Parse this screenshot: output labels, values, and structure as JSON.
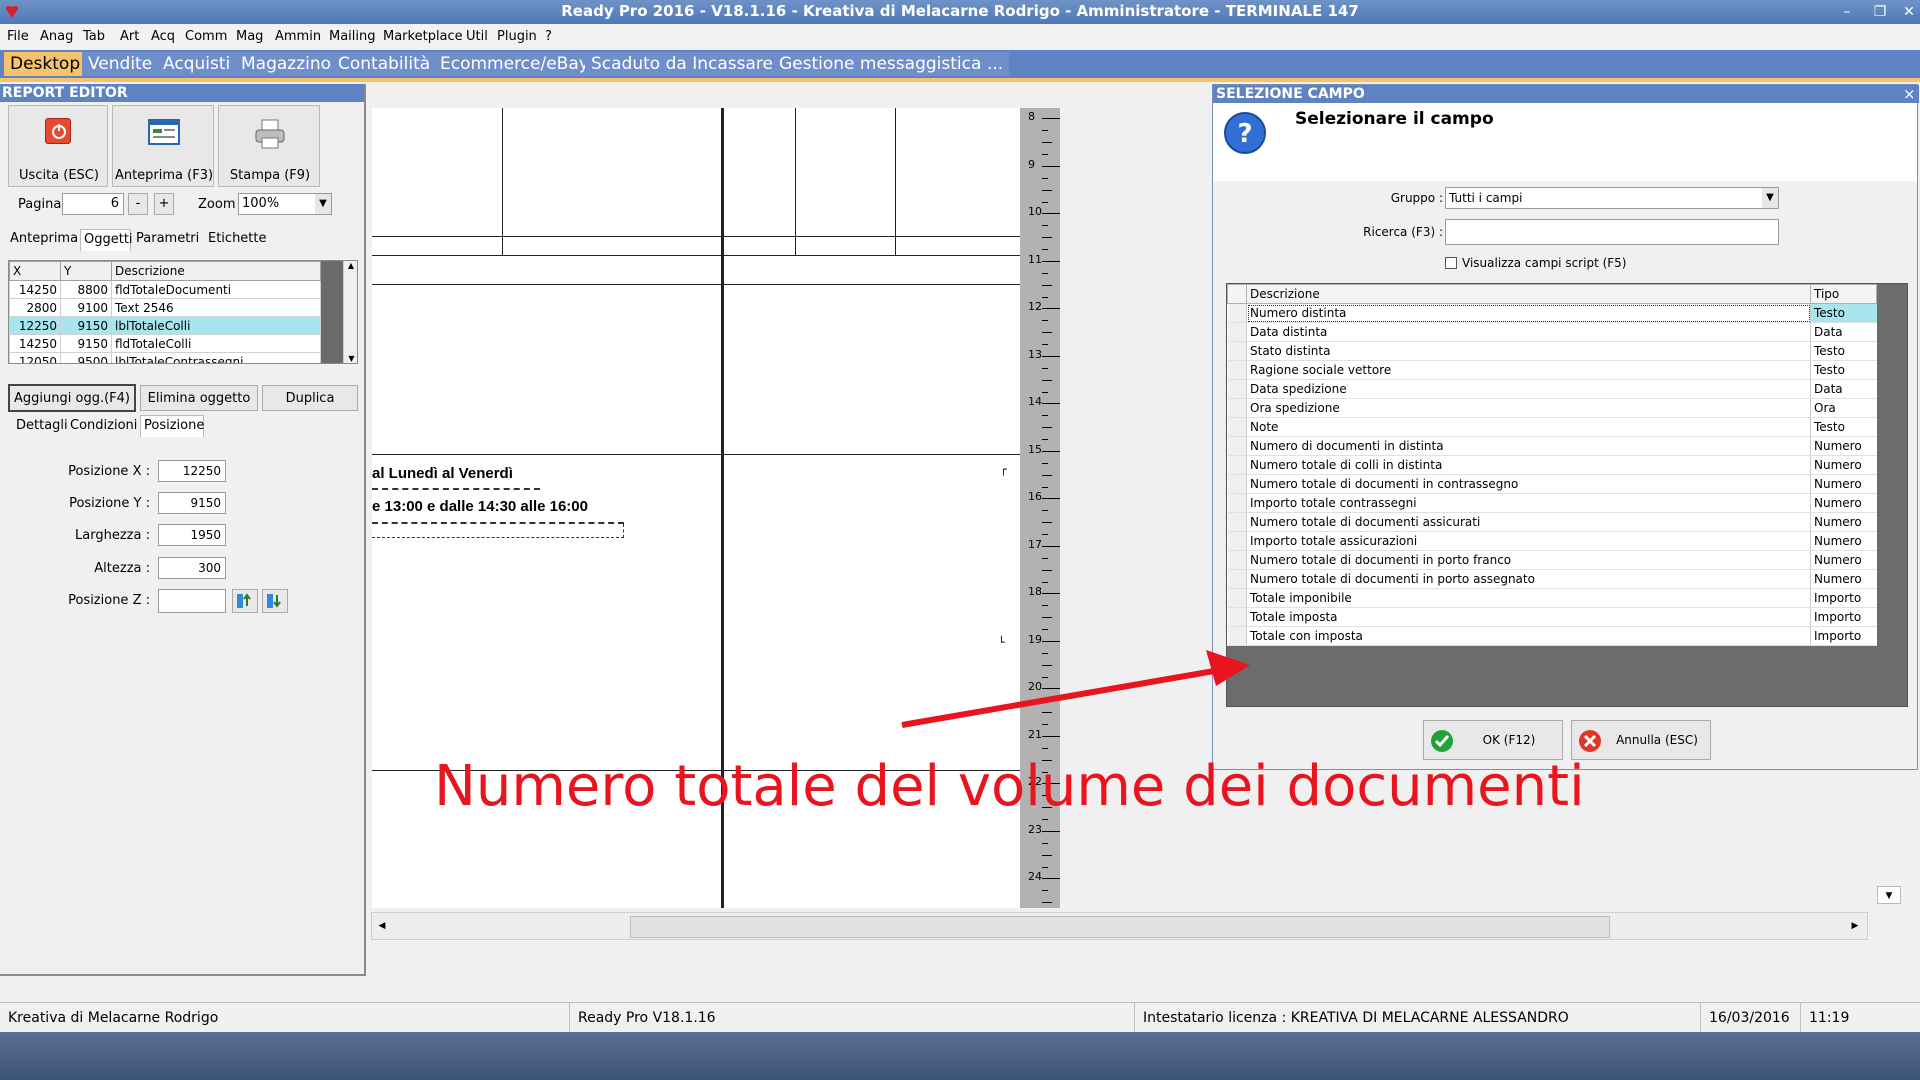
{
  "window": {
    "title": "Ready Pro 2016 - V18.1.16 - Kreativa di Melacarne Rodrigo - Amministratore - TERMINALE 147"
  },
  "menu": [
    "File",
    "Anag",
    "Tab",
    "Art",
    "Acq",
    "Comm",
    "Mag",
    "Ammin",
    "Mailing",
    "Marketplace",
    "Util",
    "Plugin",
    "?"
  ],
  "tabs": [
    "Desktop",
    "Vendite",
    "Acquisti",
    "Magazzino",
    "Contabilità",
    "Ecommerce/eBay",
    "Scaduto da Incassare",
    "Gestione messaggistica",
    "..."
  ],
  "report_editor": {
    "title": "REPORT EDITOR",
    "buttons": {
      "exit": "Uscita (ESC)",
      "preview": "Anteprima (F3)",
      "print": "Stampa (F9)"
    },
    "page_label": "Pagina",
    "page_value": "6",
    "minus": "-",
    "plus": "+",
    "zoom_label": "Zoom",
    "zoom_value": "100%",
    "tabs": [
      "Anteprima",
      "Oggetti",
      "Parametri",
      "Etichette"
    ],
    "grid_headers": [
      "X",
      "Y",
      "Descrizione"
    ],
    "grid_rows": [
      [
        "14250",
        "8800",
        "fldTotaleDocumenti"
      ],
      [
        "2800",
        "9100",
        "Text 2546"
      ],
      [
        "12250",
        "9150",
        "lblTotaleColli"
      ],
      [
        "14250",
        "9150",
        "fldTotaleColli"
      ],
      [
        "12050",
        "9500",
        "lblTotaleContrassegni"
      ]
    ],
    "action_buttons": {
      "add": "Aggiungi ogg.(F4)",
      "delete": "Elimina oggetto",
      "duplicate": "Duplica"
    },
    "detail_tabs": [
      "Dettagli",
      "Condizioni",
      "Posizione"
    ],
    "fields": {
      "pos_x_label": "Posizione X :",
      "pos_x": "12250",
      "pos_y_label": "Posizione Y :",
      "pos_y": "9150",
      "width_label": "Larghezza :",
      "width": "1950",
      "height_label": "Altezza :",
      "height": "300",
      "pos_z_label": "Posizione Z :",
      "pos_z": ""
    }
  },
  "canvas": {
    "text1": "al Lunedì al Venerdì",
    "text2": "e 13:00 e dalle 14:30 alle 16:00",
    "ruler": [
      "8",
      "9",
      "10",
      "11",
      "12",
      "13",
      "14",
      "15",
      "16",
      "17",
      "18",
      "19",
      "20",
      "21",
      "22",
      "23",
      "24"
    ]
  },
  "dialog": {
    "title": "SELEZIONE CAMPO",
    "close": "×",
    "heading": "Selezionare il campo",
    "group_label": "Gruppo :",
    "group_value": "Tutti i campi",
    "search_label": "Ricerca (F3) :",
    "search_value": "",
    "script_checkbox": "Visualizza campi script (F5)",
    "columns": [
      "Descrizione",
      "Tipo"
    ],
    "rows": [
      [
        "Numero distinta",
        "Testo"
      ],
      [
        "Data distinta",
        "Data"
      ],
      [
        "Stato distinta",
        "Testo"
      ],
      [
        "Ragione sociale vettore",
        "Testo"
      ],
      [
        "Data spedizione",
        "Data"
      ],
      [
        "Ora spedizione",
        "Ora"
      ],
      [
        "Note",
        "Testo"
      ],
      [
        "Numero di documenti in distinta",
        "Numero"
      ],
      [
        "Numero totale di colli in distinta",
        "Numero"
      ],
      [
        "Numero totale di documenti in contrassegno",
        "Numero"
      ],
      [
        "Importo totale contrassegni",
        "Numero"
      ],
      [
        "Numero totale di documenti assicurati",
        "Numero"
      ],
      [
        "Importo totale assicurazioni",
        "Numero"
      ],
      [
        "Numero totale di documenti in porto franco",
        "Numero"
      ],
      [
        "Numero totale di documenti in porto assegnato",
        "Numero"
      ],
      [
        "Totale imponibile",
        "Importo"
      ],
      [
        "Totale imposta",
        "Importo"
      ],
      [
        "Totale con imposta",
        "Importo"
      ]
    ],
    "ok": "OK (F12)",
    "cancel": "Annulla (ESC)"
  },
  "annotation": "Numero totale del volume dei documenti",
  "status": {
    "company": "Kreativa di Melacarne Rodrigo",
    "version": "Ready Pro V18.1.16",
    "license": "Intestatario licenza : KREATIVA DI MELACARNE ALESSANDRO",
    "date": "16/03/2016",
    "time": "11:19"
  },
  "colors": {
    "accent": "#5f83c2",
    "active_tab": "#f7c36a",
    "selected_row": "#a8e6ef",
    "annotation": "#e8141e"
  }
}
